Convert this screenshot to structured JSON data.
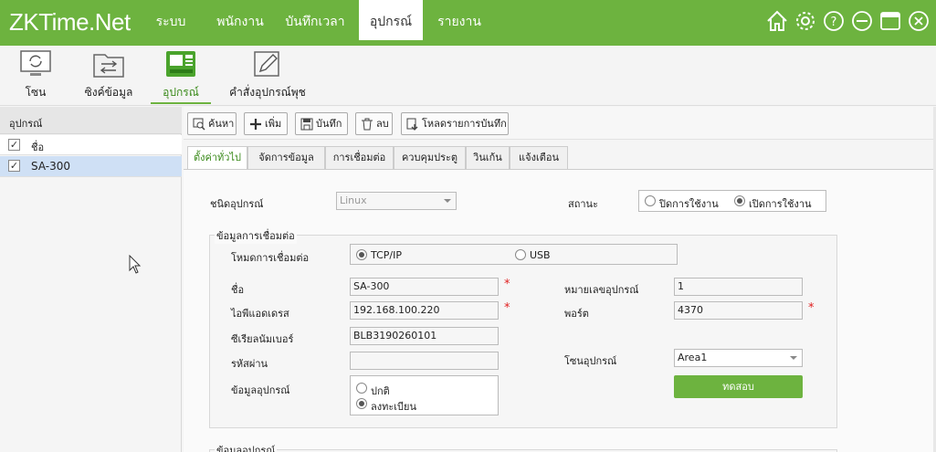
{
  "app": {
    "logo": "ZKTime.Net"
  },
  "menu": [
    "ระบบ",
    "พนักงาน",
    "บันทึกเวลา",
    "อุปกรณ์",
    "รายงาน"
  ],
  "window_icons": [
    "home-icon",
    "gear-icon",
    "help-icon",
    "minimize-icon",
    "maximize-icon",
    "close-icon"
  ],
  "ribbon": [
    "โซน",
    "ซิงค์ข้อมูล",
    "อุปกรณ์",
    "คำสั่งอุปกรณ์พุช"
  ],
  "left_panel": {
    "title": "อุปกรณ์",
    "rows": [
      {
        "label": "ชื่อ",
        "checked": true
      },
      {
        "label": "SA-300",
        "checked": true
      }
    ]
  },
  "toolbar": [
    "ค้นหา",
    "เพิ่ม",
    "บันทึก",
    "ลบ",
    "โหลดรายการบันทึก"
  ],
  "tabs": [
    "ตั้งค่าทั่วไป",
    "จัดการข้อมูล",
    "การเชื่อมต่อ",
    "ควบคุมประตู",
    "วินเก้น",
    "แจ้งเตือน"
  ],
  "general": {
    "device_type_label": "ชนิดอุปกรณ์",
    "device_type_value": "Linux",
    "status_label": "สถานะ",
    "status_options": [
      "ปิดการใช้งาน",
      "เปิดการใช้งาน"
    ],
    "status_selected": 1
  },
  "connection": {
    "title": "ข้อมูลการเชื่อมต่อ",
    "mode_label": "โหมดการเชื่อมต่อ",
    "mode_options": [
      "TCP/IP",
      "USB"
    ],
    "mode_selected": 0,
    "name_label": "ชื่อ",
    "name_value": "SA-300",
    "ip_label": "ไอพีแอดเดรส",
    "ip_value": "192.168.100.220",
    "serial_label": "ซีเรียลนัมเบอร์",
    "serial_value": "BLB3190260101",
    "password_label": "รหัสผ่าน",
    "password_value": "",
    "info_label": "ข้อมูลอุปกรณ์",
    "info_options": [
      "ปกติ",
      "ลงทะเบียน"
    ],
    "info_selected": 1,
    "devno_label": "หมายเลขอุปกรณ์",
    "devno_value": "1",
    "port_label": "พอร์ต",
    "port_value": "4370",
    "zone_label": "โซนอุปกรณ์",
    "zone_value": "Area1",
    "test_label": "ทดสอบ",
    "required_mark": "*"
  },
  "device_info": {
    "title": "ข้อมูลอุปกรณ์"
  },
  "colors": {
    "green": "#6db33f",
    "test_button": "#6db33f"
  }
}
